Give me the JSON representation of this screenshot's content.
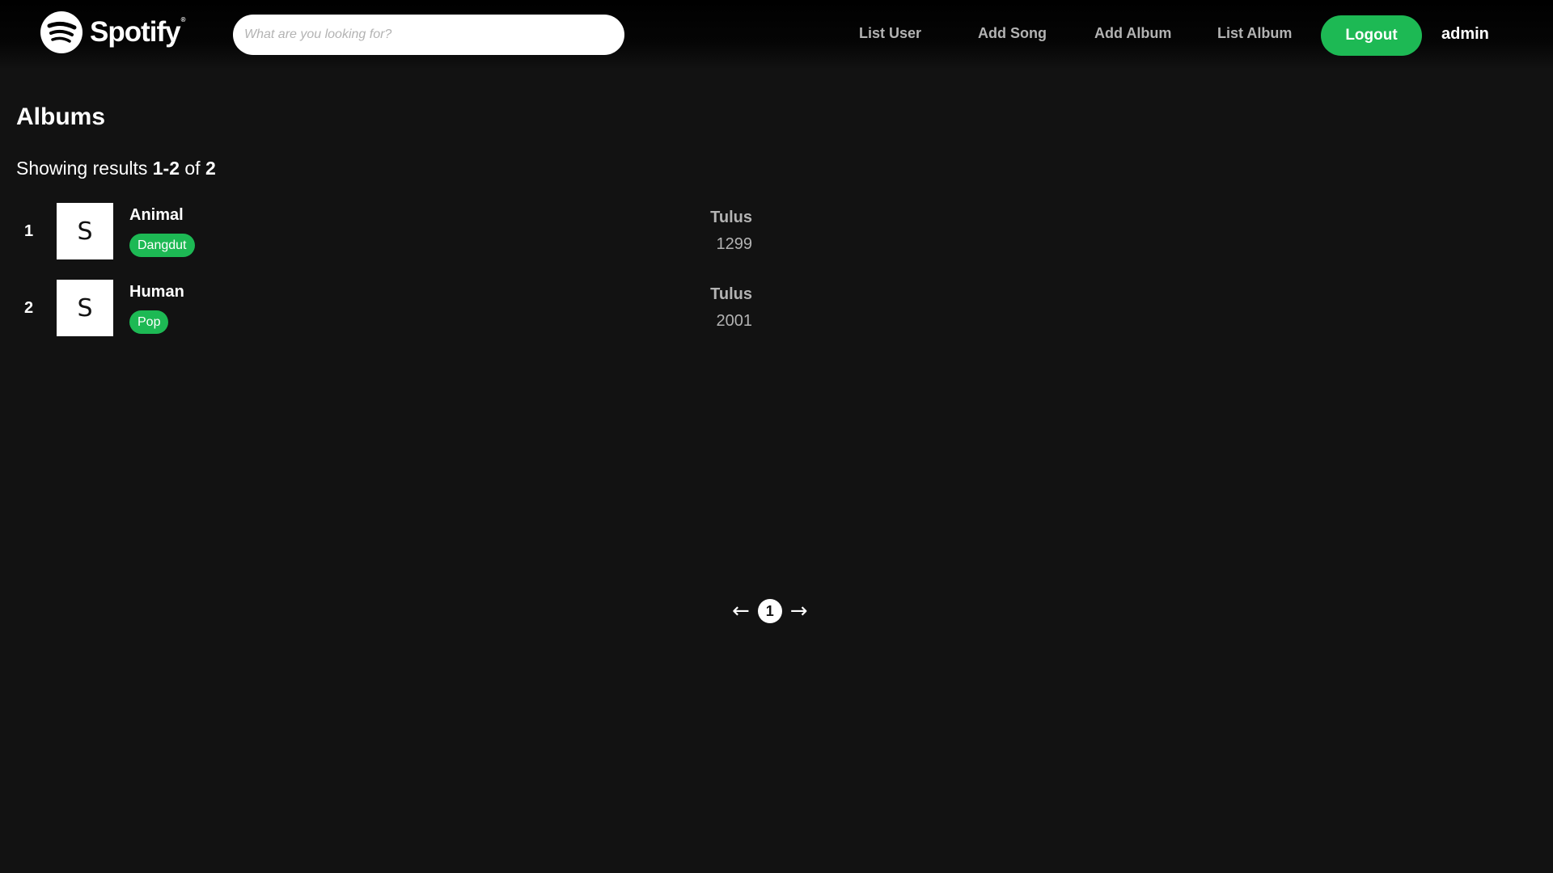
{
  "header": {
    "logo_text": "Spotify",
    "logo_tm": "®",
    "search_placeholder": "What are you looking for?",
    "nav": [
      {
        "label": "List User"
      },
      {
        "label": "Add Song"
      },
      {
        "label": "Add Album"
      },
      {
        "label": "List Album"
      }
    ],
    "logout_label": "Logout",
    "username": "admin"
  },
  "main": {
    "title": "Albums",
    "results": {
      "prefix": "Showing results ",
      "range": "1-2",
      "middle": " of ",
      "total": "2"
    },
    "albums": [
      {
        "index": "1",
        "cover_letter": "S",
        "name": "Animal",
        "genre": "Dangdut",
        "artist": "Tulus",
        "year": "1299"
      },
      {
        "index": "2",
        "cover_letter": "S",
        "name": "Human",
        "genre": "Pop",
        "artist": "Tulus",
        "year": "2001"
      }
    ]
  },
  "pagination": {
    "prev": "←",
    "current_page": "1",
    "next": "→"
  },
  "colors": {
    "background": "#121212",
    "accent": "#1db954",
    "muted_text": "#b3b3b3"
  },
  "icons": {
    "logo": "spotify-logo-icon"
  }
}
